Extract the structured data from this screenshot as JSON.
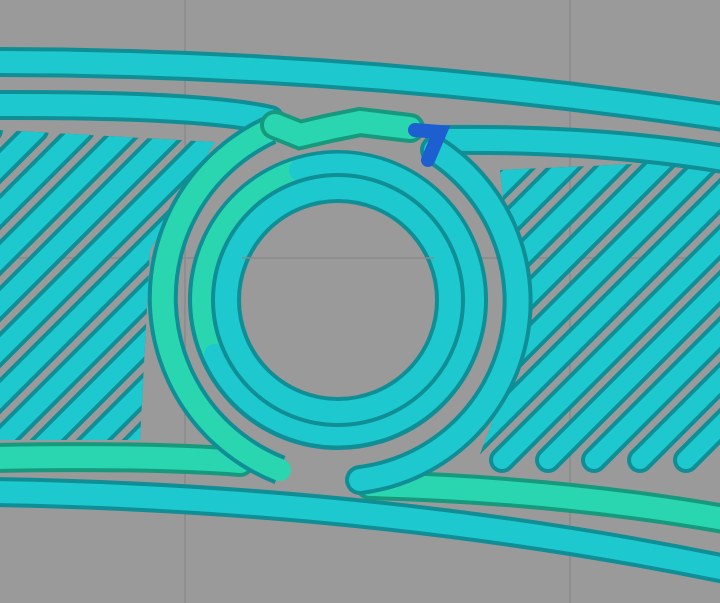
{
  "scene": {
    "description_visible_text": "",
    "colors": {
      "background": "#9a9a9a",
      "grid_line": "#8a8a8a",
      "perimeter": "#1ec8cf",
      "perimeter_shade": "#0f8e96",
      "perimeter_highlight": "#7ff0f2",
      "inner_perimeter": "#2ad6b0",
      "inner_perimeter_shade": "#17997e",
      "infill": "#1ec8cf",
      "infill_shade": "#0f8e96",
      "travel_accent": "#1d5fd0"
    }
  }
}
